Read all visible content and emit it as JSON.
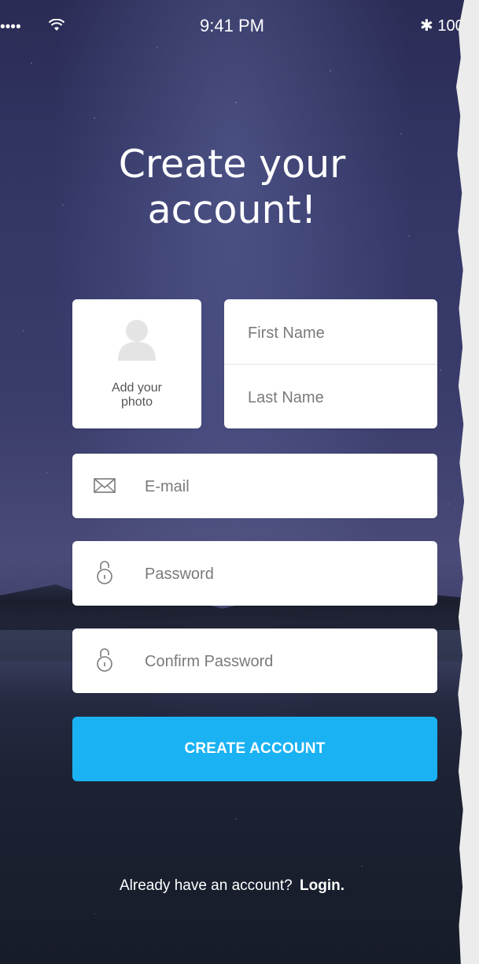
{
  "status_bar": {
    "signal": "••••",
    "time": "9:41 PM",
    "battery": "100"
  },
  "title": {
    "line1": "Create your",
    "line2": "account!"
  },
  "photo": {
    "label": "Add your photo"
  },
  "fields": {
    "first_name_placeholder": "First Name",
    "last_name_placeholder": "Last Name",
    "email_placeholder": "E-mail",
    "password_placeholder": "Password",
    "confirm_placeholder": "Confirm Password"
  },
  "button": {
    "label": "CREATE ACCOUNT"
  },
  "footer": {
    "prompt": "Already have an account?",
    "login": "Login."
  },
  "colors": {
    "accent": "#1ab2f3"
  },
  "icons": [
    "wifi-icon",
    "bluetooth-icon",
    "user-avatar-icon",
    "mail-icon",
    "lock-icon"
  ]
}
